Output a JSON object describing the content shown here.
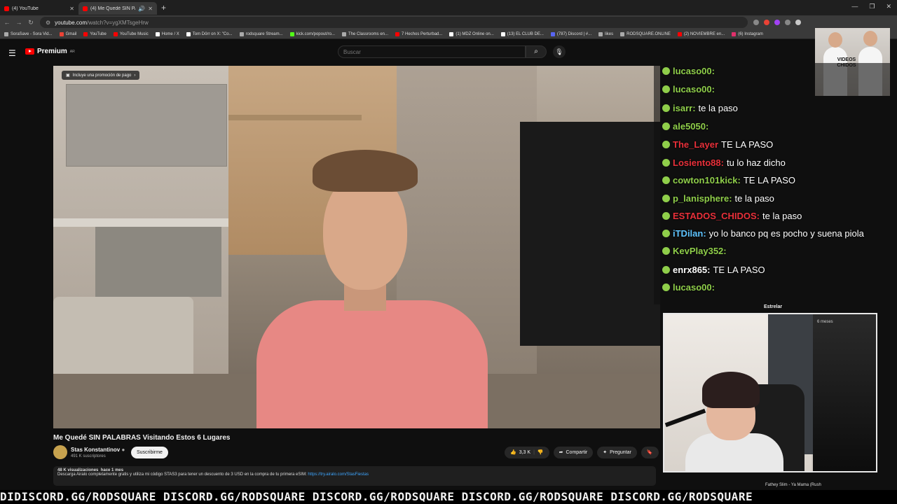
{
  "browser": {
    "tabs": [
      {
        "title": "(4) YouTube",
        "active": false
      },
      {
        "title": "(4) Me Quedé SIN PALABR",
        "active": true
      }
    ],
    "url_host": "youtube.com",
    "url_path": "/watch?v=ygXMTsgeHrw",
    "bookmarks": [
      "SoraSave - Sora Vid...",
      "Gmail",
      "YouTube",
      "YouTube Music",
      "Home / X",
      "Tom Dörr on X: \"Co...",
      "rodsquare Stream...",
      "kick.com/popout/ro...",
      "The Classrooms en...",
      "7 Hechos Perturbad...",
      "(1) MDZ Online on...",
      "(13) EL CLUB DE...",
      "(787) Discord | #...",
      "likes",
      "RODSQUARE.ONLINE",
      "(2) NOVIEMBRE en...",
      "(6) Instagram"
    ]
  },
  "youtube": {
    "logo_text": "Premium",
    "logo_region": "AR",
    "search_placeholder": "Buscar",
    "promo_label": "Incluye una promoción de pago",
    "video_title": "Me Quedé SIN PALABRAS Visitando Estos 6 Lugares",
    "channel_name": "Stas Konstantinov",
    "subscribers": "491 K suscriptores",
    "subscribe_label": "Suscribirme",
    "likes": "3,3 K",
    "share_label": "Compartir",
    "ask_label": "Preguntar",
    "views": "48 K visualizaciones",
    "published": "hace 1 mes",
    "description": "Descarga Airalo completamente gratis y utiliza mi código STAS3 para tener un descuento de 3 USD en la compra de tu primera eSIM:",
    "description_link": "https://try.airalo.com/StasFiestas"
  },
  "chat": {
    "messages": [
      {
        "user": "lucaso00:",
        "text": "",
        "color": "green"
      },
      {
        "user": "lucaso00:",
        "text": "",
        "color": "green"
      },
      {
        "user": "isarr:",
        "text": "te la paso",
        "color": "green"
      },
      {
        "user": "ale5050:",
        "text": "",
        "color": "green"
      },
      {
        "user": "The_Layer",
        "text": "TE LA PASO",
        "color": "red"
      },
      {
        "user": "Losiento88:",
        "text": "tu lo haz dicho",
        "color": "red"
      },
      {
        "user": "cowton101kick:",
        "text": "TE LA PASO",
        "color": "green"
      },
      {
        "user": "p_lanisphere:",
        "text": "te la paso",
        "color": "green"
      },
      {
        "user": "ESTADOS_CHIDOS:",
        "text": "te la paso",
        "color": "red"
      },
      {
        "user": "iTDilan:",
        "text": "yo lo banco pq es pocho y suena piola",
        "color": "blue"
      },
      {
        "user": "KevPlay352:",
        "text": "",
        "color": "green"
      },
      {
        "user": "enrx865:",
        "text": "TE LA PASO",
        "color": "plain"
      },
      {
        "user": "lucaso00:",
        "text": "",
        "color": "green"
      }
    ],
    "sticker_label": "VIDEOS CHIDOS",
    "next_label": "Estrelar"
  },
  "webcam": {
    "meta": "6 meses",
    "side_label": "Fathey Slim - Ya Mama (Rush"
  },
  "ticker": {
    "text": "DIDISCORD.GG/RODSQUARE  DISCORD.GG/RODSQUARE  DISCORD.GG/RODSQUARE  DISCORD.GG/RODSQUARE  DISCORD.GG/RODSQUARE"
  },
  "colors": {
    "youtube_red": "#ff0000",
    "chat_green": "#8fce4a",
    "chat_red": "#e8303a",
    "chat_blue": "#5ec3ff",
    "shirt_pink": "#e78884"
  }
}
